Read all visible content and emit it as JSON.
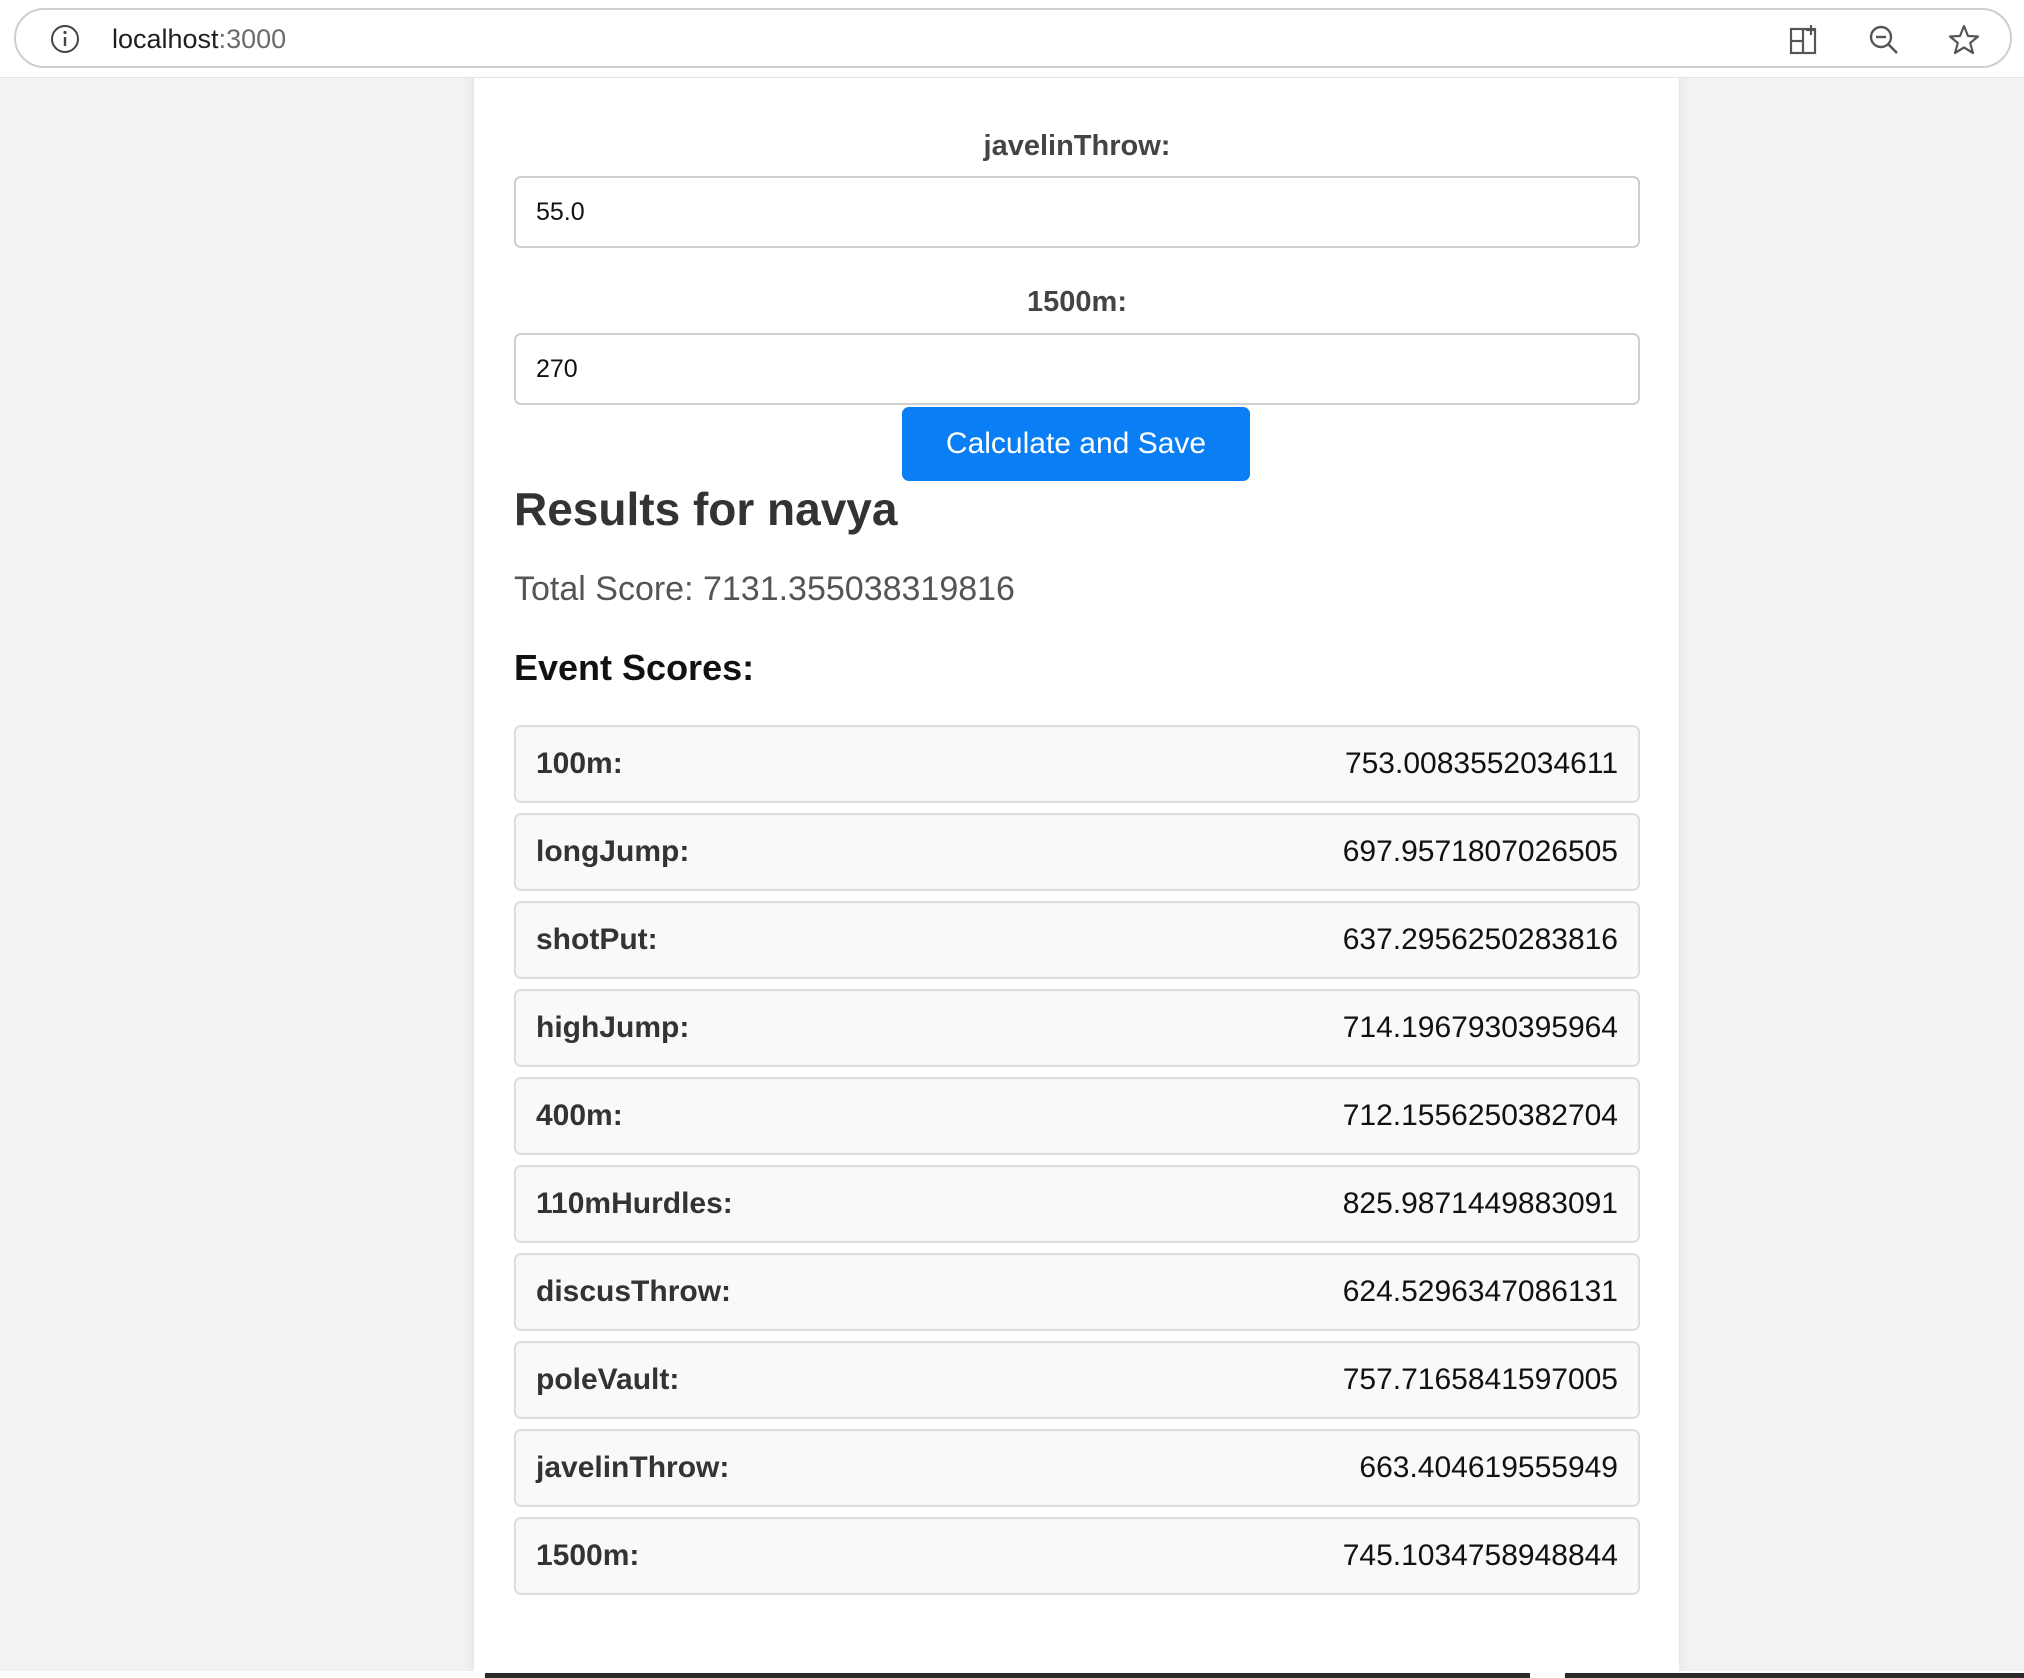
{
  "browser": {
    "url_host": "localhost",
    "url_port": ":3000"
  },
  "form": {
    "partial_label": "javelinThrow:",
    "javelin_value": "55.0",
    "label_1500m": "1500m:",
    "value_1500m": "270",
    "submit_label": "Calculate and Save"
  },
  "results": {
    "title": "Results for navya",
    "total_score": "Total Score: 7131.355038319816",
    "event_scores_heading": "Event Scores:",
    "events": [
      {
        "name": "100m:",
        "score": "753.0083552034611"
      },
      {
        "name": "longJump:",
        "score": "697.9571807026505"
      },
      {
        "name": "shotPut:",
        "score": "637.2956250283816"
      },
      {
        "name": "highJump:",
        "score": "714.1967930395964"
      },
      {
        "name": "400m:",
        "score": "712.1556250382704"
      },
      {
        "name": "110mHurdles:",
        "score": "825.9871449883091"
      },
      {
        "name": "discusThrow:",
        "score": "624.5296347086131"
      },
      {
        "name": "poleVault:",
        "score": "757.7165841597005"
      },
      {
        "name": "javelinThrow:",
        "score": "663.404619555949"
      },
      {
        "name": "1500m:",
        "score": "745.1034758948844"
      }
    ]
  },
  "colors": {
    "button_blue": "#0a7ff5",
    "page_bg": "#f2f2f2",
    "row_bg": "#f9f9f9"
  },
  "icons": [
    "info-icon",
    "split-screen-icon",
    "zoom-out-icon",
    "favorite-star-icon"
  ]
}
